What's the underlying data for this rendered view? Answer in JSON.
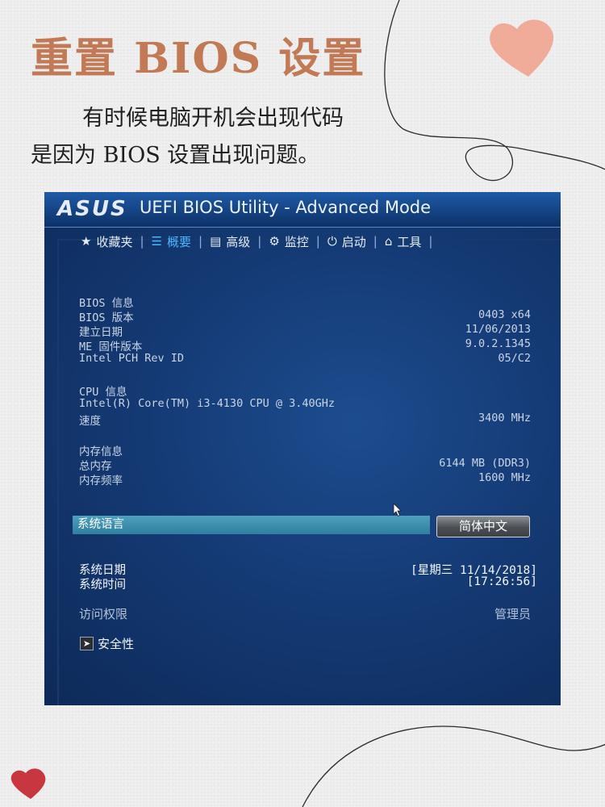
{
  "title": "重置 BIOS 设置",
  "intro": {
    "line1": "有时候电脑开机会出现代码",
    "line2": "是因为 BIOS 设置出现问题。"
  },
  "colors": {
    "title_accent": "#c17a55",
    "heart_pink": "#f0a08a",
    "heart_red": "#c8363f",
    "bios_blue": "#143a74",
    "active_tab": "#4fb4ff"
  },
  "bios": {
    "logo": "ASUS",
    "window_title": "UEFI BIOS Utility - Advanced Mode",
    "tabs": [
      {
        "label": "收藏夹",
        "icon": "star-icon"
      },
      {
        "label": "概要",
        "icon": "list-icon",
        "active": true
      },
      {
        "label": "高级",
        "icon": "advanced-icon"
      },
      {
        "label": "监控",
        "icon": "monitor-icon"
      },
      {
        "label": "启动",
        "icon": "power-icon"
      },
      {
        "label": "工具",
        "icon": "tool-icon"
      }
    ],
    "bios_info": {
      "heading": "BIOS 信息",
      "rows": [
        {
          "label": "BIOS 版本",
          "value": "0403 x64"
        },
        {
          "label": "建立日期",
          "value": "11/06/2013"
        },
        {
          "label": "ME 固件版本",
          "value": "9.0.2.1345"
        },
        {
          "label": "Intel PCH Rev ID",
          "value": "05/C2"
        }
      ]
    },
    "cpu_info": {
      "heading": "CPU 信息",
      "model": "Intel(R) Core(TM) i3-4130 CPU @ 3.40GHz",
      "speed_label": "速度",
      "speed_value": "3400 MHz"
    },
    "memory_info": {
      "heading": "内存信息",
      "total_label": "总内存",
      "total_value": "6144 MB (DDR3)",
      "freq_label": "内存频率",
      "freq_value": "1600 MHz"
    },
    "language": {
      "label": "系统语言",
      "value": "简体中文"
    },
    "date": {
      "label": "系统日期",
      "value": "[星期三 11/14/2018]"
    },
    "time": {
      "label": "系统时间",
      "value": "[17:26:56]"
    },
    "access": {
      "label": "访问权限",
      "value": "管理员"
    },
    "security": {
      "label": "安全性"
    }
  }
}
